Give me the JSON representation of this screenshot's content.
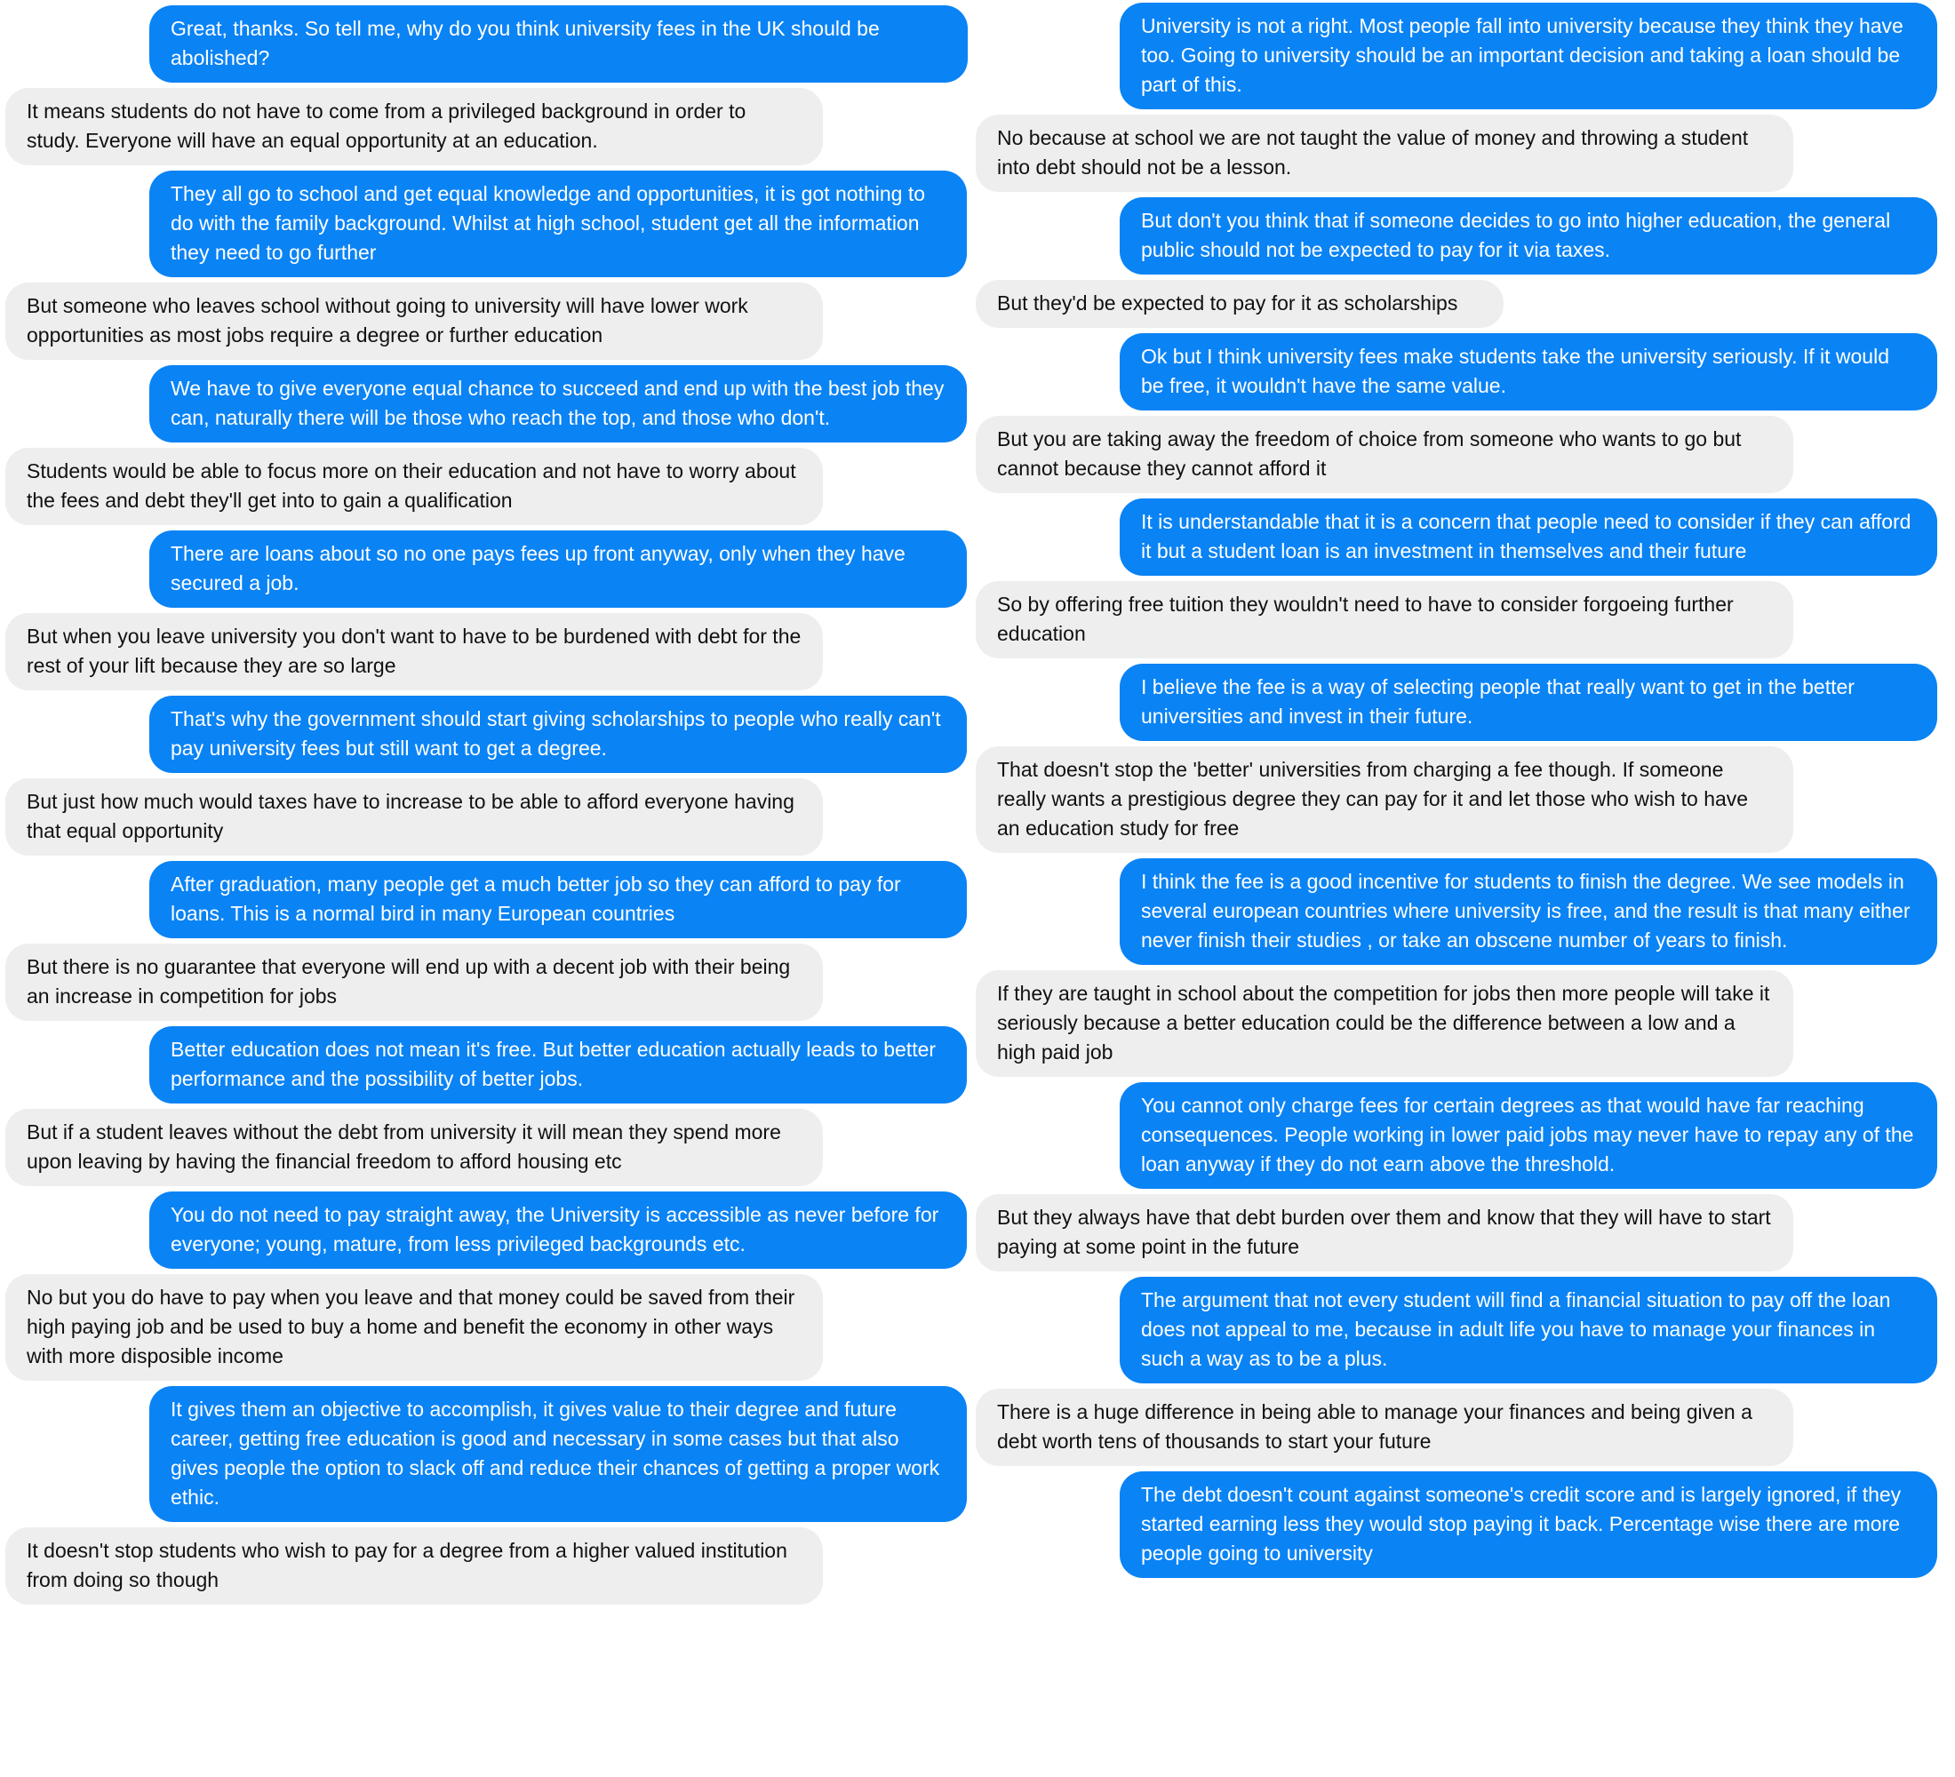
{
  "conversation": {
    "left": [
      {
        "from": "sent",
        "text": "Great, thanks. So tell me, why do you think university fees in the UK should be abolished?"
      },
      {
        "from": "received",
        "text": "It means students do not have to come from a privileged background in order to study. Everyone will have an equal opportunity at an education."
      },
      {
        "from": "sent",
        "text": "They all go to school and get equal knowledge and opportunities, it is got nothing to do with the family background. Whilst at high school, student get all the information they need to go further"
      },
      {
        "from": "received",
        "text": "But someone who leaves school without going to university will have lower work opportunities as most jobs require a degree or further education"
      },
      {
        "from": "sent",
        "text": "We have to give everyone equal chance to succeed and end up with the best job they can, naturally there will be those who reach the top, and those who don't."
      },
      {
        "from": "received",
        "text": "Students would be able to focus more on their education and not have to worry about the fees and debt they'll get into to gain a qualification"
      },
      {
        "from": "sent",
        "text": "There are loans about so no one pays fees up front anyway, only when they have secured a job."
      },
      {
        "from": "received",
        "text": "But when you leave university you don't want to have to be burdened with debt for the rest of your lift because they are so large"
      },
      {
        "from": "sent",
        "text": "That's why the government should start giving scholarships to people who really can't pay university fees but still want to get a degree."
      },
      {
        "from": "received",
        "text": "But just how much would taxes have to increase to be able to afford everyone having that equal opportunity"
      },
      {
        "from": "sent",
        "text": "After graduation, many people get a much better job so they can afford to pay for loans. This is a normal bird in many European countries"
      },
      {
        "from": "received",
        "text": "But there is no guarantee that everyone will end up with a decent job with their being an increase in competition for jobs"
      },
      {
        "from": "sent",
        "text": "Better education does not mean it's free. But better education actually leads to better performance and the possibility of better jobs."
      },
      {
        "from": "received",
        "text": "But if a student leaves without the debt from university it will mean they spend more upon leaving by having the financial freedom to afford housing etc"
      },
      {
        "from": "sent",
        "text": "You do not need to pay straight away, the University is accessible as never before for everyone; young, mature, from less privileged backgrounds etc."
      },
      {
        "from": "received",
        "text": "No but you do have to pay when you leave and that money could be saved from their high paying job and be used to buy a home and benefit the economy in other ways with more disposible income"
      },
      {
        "from": "sent",
        "text": "It gives them an objective to accomplish, it gives value to their degree and future career, getting free education is good and necessary in some cases but that also gives people the option to slack off and reduce their chances of getting a proper work ethic."
      },
      {
        "from": "received",
        "text": "It doesn't stop students who wish to pay for a degree from a higher valued institution from doing so though"
      }
    ],
    "right": [
      {
        "from": "sent",
        "text": "University is not a right. Most people fall into university because they think they have too. Going to university should be an important decision and taking a loan should be part of this."
      },
      {
        "from": "received",
        "text": "No because at school we are not taught the value of money and throwing a student into debt should not be a lesson."
      },
      {
        "from": "sent",
        "text": "But don't you think that if someone decides to go into higher education, the general public should not be expected to pay for it via taxes."
      },
      {
        "from": "received",
        "text": "But they'd be expected to pay for it as scholarships"
      },
      {
        "from": "sent",
        "text": "Ok but I think university fees make students take the university seriously. If it would be free, it wouldn't have the same value."
      },
      {
        "from": "received",
        "text": "But you are taking away the freedom of choice from someone who wants to go but cannot because they cannot afford it"
      },
      {
        "from": "sent",
        "text": "It is understandable that it is a concern that people need to consider if they can afford it but a student loan is an investment in themselves and their future"
      },
      {
        "from": "received",
        "text": "So by offering free tuition they wouldn't need to have to consider forgoeing further education"
      },
      {
        "from": "sent",
        "text": "I believe the fee is a way of selecting people that really want to get in the better universities and invest in their future."
      },
      {
        "from": "received",
        "text": "That doesn't stop the 'better' universities from charging a fee though. If someone really wants a prestigious degree they can pay for it and let those who wish to have an education study for free"
      },
      {
        "from": "sent",
        "text": "I think the fee is a good incentive for students to finish the degree. We see models in several european countries where university is free, and the result is that many either never finish their studies , or take an obscene number of years to finish."
      },
      {
        "from": "received",
        "text": "If they are taught in school about the competition for jobs then more people will take it seriously because a better education could be the difference between a low and a high paid job"
      },
      {
        "from": "sent",
        "text": "You cannot only charge fees for certain degrees as that would have far reaching consequences. People working in lower paid jobs may never have to repay any of the loan anyway if they do not earn above the threshold."
      },
      {
        "from": "received",
        "text": "But they always have that debt burden over them and know that they will have to start paying at some point in the future"
      },
      {
        "from": "sent",
        "text": "The argument that not every student will find a financial situation to pay off the loan does not appeal to me, because in adult life you have to manage your finances in such a way as to be a plus."
      },
      {
        "from": "received",
        "text": "There is a huge difference in being able to manage your finances and being given a debt worth tens of thousands to start your future"
      },
      {
        "from": "sent",
        "text": "The debt doesn't count against someone's credit score and is largely ignored, if they started earning less they would stop paying it back. Percentage wise there are more people going to university"
      }
    ]
  },
  "colors": {
    "sent_bubble": "#0a83f5",
    "received_bubble": "#eeeeee"
  }
}
